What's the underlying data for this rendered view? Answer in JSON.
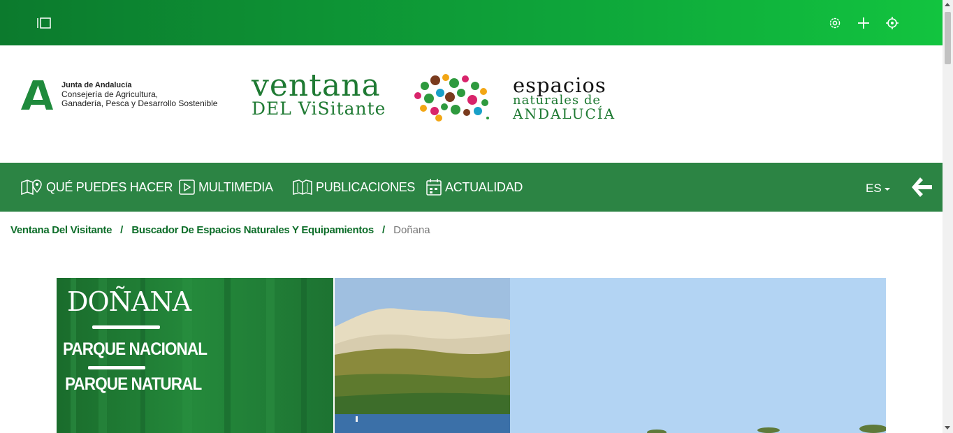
{
  "topbar": {
    "icons": [
      "sidebar-toggle-icon",
      "settings-icon",
      "plus-icon",
      "crosshair-icon"
    ],
    "gradient": [
      "#0c7a2d",
      "#12c43f"
    ]
  },
  "header": {
    "junta": {
      "line1": "Junta de Andalucía",
      "line2": "Consejería de Agricultura,",
      "line3": "Ganadería, Pesca y Desarrollo Sostenible"
    },
    "ventana": {
      "line1": "ventana",
      "line2": "DEL ViSitante"
    },
    "espacios": {
      "line1": "espacios",
      "line2": "naturales de",
      "line3": "ANDALUCÍA"
    }
  },
  "nav": {
    "background": "#2c8444",
    "items": [
      {
        "label": "QUÉ PUEDES HACER",
        "icon": "map-pin-icon"
      },
      {
        "label": "MULTIMEDIA",
        "icon": "play-icon"
      },
      {
        "label": "PUBLICACIONES",
        "icon": "book-icon"
      },
      {
        "label": "ACTUALIDAD",
        "icon": "calendar-icon"
      }
    ],
    "language": "ES"
  },
  "breadcrumb": {
    "items": [
      "Ventana Del Visitante",
      "Buscador De Espacios Naturales Y Equipamientos"
    ],
    "current": "Doñana",
    "separator": "/"
  },
  "banner": {
    "title": "DOÑANA",
    "subtitle1": "PARQUE NACIONAL",
    "subtitle2": "PARQUE NATURAL"
  }
}
